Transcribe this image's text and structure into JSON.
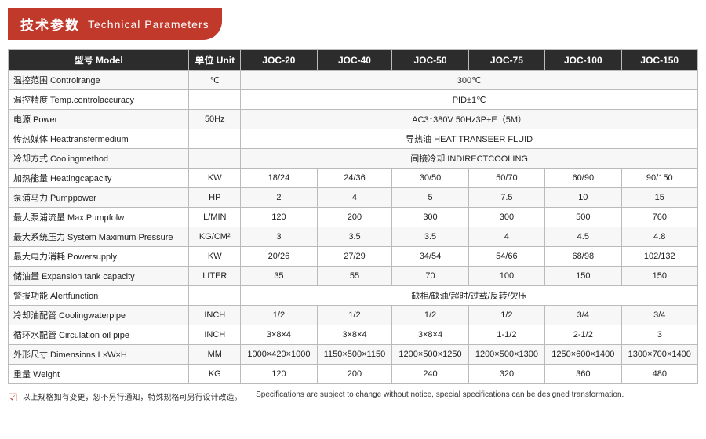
{
  "header": {
    "cn": "技术参数",
    "en": "Technical Parameters"
  },
  "table": {
    "columns": [
      "型号 Model",
      "单位 Unit",
      "JOC-20",
      "JOC-40",
      "JOC-50",
      "JOC-75",
      "JOC-100",
      "JOC-150"
    ],
    "rows": [
      {
        "label": "温控范围 Controlrange",
        "unit": "℃",
        "values": [
          "300℃",
          null,
          null,
          null,
          null,
          null
        ],
        "span": 6
      },
      {
        "label": "温控精度 Temp.controlaccuracy",
        "unit": "",
        "values": [
          "PID±1℃",
          null,
          null,
          null,
          null,
          null
        ],
        "span": 6
      },
      {
        "label": "电源 Power",
        "unit": "50Hz",
        "values": [
          "AC3↑380V 50Hz3P+E（5M）",
          null,
          null,
          null,
          null,
          null
        ],
        "span": 6
      },
      {
        "label": "传热媒体 Heattransfermedium",
        "unit": "",
        "values": [
          "导热油 HEAT TRANSEER FLUID",
          null,
          null,
          null,
          null,
          null
        ],
        "span": 6
      },
      {
        "label": "冷却方式 Coolingmethod",
        "unit": "",
        "values": [
          "间接冷却 INDIRECTCOOLING",
          null,
          null,
          null,
          null,
          null
        ],
        "span": 6
      },
      {
        "label": "加热能量 Heatingcapacity",
        "unit": "KW",
        "values": [
          "18/24",
          "24/36",
          "30/50",
          "50/70",
          "60/90",
          "90/150"
        ],
        "span": 1
      },
      {
        "label": "泵浦马力 Pumppower",
        "unit": "HP",
        "values": [
          "2",
          "4",
          "5",
          "7.5",
          "10",
          "15"
        ],
        "span": 1
      },
      {
        "label": "最大泵浦流量 Max.Pumpfolw",
        "unit": "L/MIN",
        "values": [
          "120",
          "200",
          "300",
          "300",
          "500",
          "760"
        ],
        "span": 1
      },
      {
        "label": "最大系统压力 System Maximum Pressure",
        "unit": "KG/CM²",
        "values": [
          "3",
          "3.5",
          "3.5",
          "4",
          "4.5",
          "4.8"
        ],
        "span": 1
      },
      {
        "label": "最大电力消耗 Powersupply",
        "unit": "KW",
        "values": [
          "20/26",
          "27/29",
          "34/54",
          "54/66",
          "68/98",
          "102/132"
        ],
        "span": 1
      },
      {
        "label": "储油量 Expansion tank capacity",
        "unit": "LITER",
        "values": [
          "35",
          "55",
          "70",
          "100",
          "150",
          "150"
        ],
        "span": 1
      },
      {
        "label": "警报功能 Alertfunction",
        "unit": "",
        "values": [
          "缺相/缺油/超时/过载/反转/欠压",
          null,
          null,
          null,
          null,
          null
        ],
        "span": 6
      },
      {
        "label": "冷却油配管 Coolingwaterpipe",
        "unit": "INCH",
        "values": [
          "1/2",
          "1/2",
          "1/2",
          "1/2",
          "3/4",
          "3/4"
        ],
        "span": 1
      },
      {
        "label": "循环水配管 Circulation oil pipe",
        "unit": "INCH",
        "values": [
          "3×8×4",
          "3×8×4",
          "3×8×4",
          "1-1/2",
          "2-1/2",
          "3"
        ],
        "span": 1
      },
      {
        "label": "外形尺寸 Dimensions L×W×H",
        "unit": "MM",
        "values": [
          "1000×420×1000",
          "1150×500×1150",
          "1200×500×1250",
          "1200×500×1300",
          "1250×600×1400",
          "1300×700×1400"
        ],
        "span": 1
      },
      {
        "label": "重量 Weight",
        "unit": "KG",
        "values": [
          "120",
          "200",
          "240",
          "320",
          "360",
          "480"
        ],
        "span": 1
      }
    ]
  },
  "footer": {
    "cn": "以上规格如有变更，恕不另行通知，特殊规格可另行设计改造。",
    "en": "Specifications are subject to change without notice, special specifications can be designed transformation."
  }
}
